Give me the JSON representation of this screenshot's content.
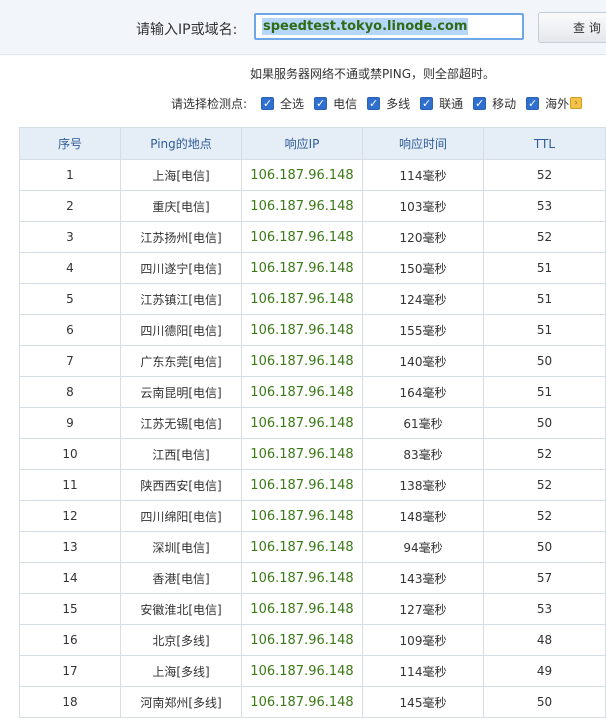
{
  "search": {
    "label": "请输入IP或域名:",
    "value": "speedtest.tokyo.linode.com",
    "button": "查 询"
  },
  "notice": "如果服务器网络不通或禁PING，则全部超时。",
  "nodes": {
    "label": "请选择检测点:",
    "options": [
      {
        "label": "全选",
        "checked": true
      },
      {
        "label": "电信",
        "checked": true
      },
      {
        "label": "多线",
        "checked": true
      },
      {
        "label": "联通",
        "checked": true
      },
      {
        "label": "移动",
        "checked": true
      },
      {
        "label": "海外",
        "checked": true
      }
    ]
  },
  "table": {
    "headers": [
      "序号",
      "Ping的地点",
      "响应IP",
      "响应时间",
      "TTL"
    ],
    "rows": [
      [
        "1",
        "上海[电信]",
        "106.187.96.148",
        "114毫秒",
        "52"
      ],
      [
        "2",
        "重庆[电信]",
        "106.187.96.148",
        "103毫秒",
        "53"
      ],
      [
        "3",
        "江苏扬州[电信]",
        "106.187.96.148",
        "120毫秒",
        "52"
      ],
      [
        "4",
        "四川遂宁[电信]",
        "106.187.96.148",
        "150毫秒",
        "51"
      ],
      [
        "5",
        "江苏镇江[电信]",
        "106.187.96.148",
        "124毫秒",
        "51"
      ],
      [
        "6",
        "四川德阳[电信]",
        "106.187.96.148",
        "155毫秒",
        "51"
      ],
      [
        "7",
        "广东东莞[电信]",
        "106.187.96.148",
        "140毫秒",
        "50"
      ],
      [
        "8",
        "云南昆明[电信]",
        "106.187.96.148",
        "164毫秒",
        "51"
      ],
      [
        "9",
        "江苏无锡[电信]",
        "106.187.96.148",
        "61毫秒",
        "50"
      ],
      [
        "10",
        "江西[电信]",
        "106.187.96.148",
        "83毫秒",
        "52"
      ],
      [
        "11",
        "陕西西安[电信]",
        "106.187.96.148",
        "138毫秒",
        "52"
      ],
      [
        "12",
        "四川绵阳[电信]",
        "106.187.96.148",
        "148毫秒",
        "52"
      ],
      [
        "13",
        "深圳[电信]",
        "106.187.96.148",
        "94毫秒",
        "50"
      ],
      [
        "14",
        "香港[电信]",
        "106.187.96.148",
        "143毫秒",
        "57"
      ],
      [
        "15",
        "安徽淮北[电信]",
        "106.187.96.148",
        "127毫秒",
        "53"
      ],
      [
        "16",
        "北京[多线]",
        "106.187.96.148",
        "109毫秒",
        "48"
      ],
      [
        "17",
        "上海[多线]",
        "106.187.96.148",
        "114毫秒",
        "49"
      ],
      [
        "18",
        "河南郑州[多线]",
        "106.187.96.148",
        "145毫秒",
        "50"
      ]
    ]
  }
}
